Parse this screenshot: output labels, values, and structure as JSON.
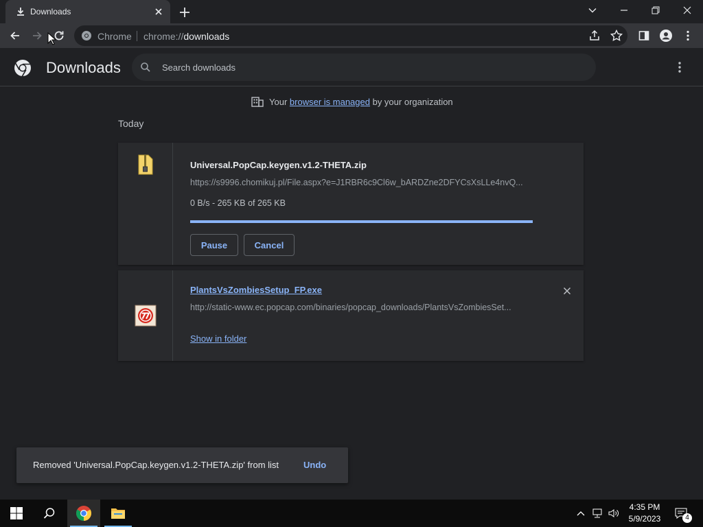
{
  "tab": {
    "title": "Downloads"
  },
  "omnibox": {
    "chip": "Chrome",
    "url_scheme": "chrome://",
    "url_host": "downloads"
  },
  "page": {
    "title": "Downloads",
    "search_placeholder": "Search downloads"
  },
  "managed": {
    "prefix": "Your",
    "link": "browser is managed",
    "suffix": "by your organization"
  },
  "section_date": "Today",
  "downloads": [
    {
      "name": "Universal.PopCap.keygen.v1.2-THETA.zip",
      "url": "https://s9996.chomikuj.pl/File.aspx?e=J1RBR6c9Cl6w_bARDZne2DFYCsXsLLe4nvQ...",
      "status": "0 B/s - 265 KB of 265 KB",
      "progress": 1.0,
      "pause_label": "Pause",
      "cancel_label": "Cancel"
    },
    {
      "name": "PlantsVsZombiesSetup_FP.exe",
      "url": "http://static-www.ec.popcap.com/binaries/popcap_downloads/PlantsVsZombiesSet...",
      "show_in_folder_label": "Show in folder"
    }
  ],
  "toast": {
    "message": "Removed 'Universal.PopCap.keygen.v1.2-THETA.zip' from list",
    "undo_label": "Undo"
  },
  "taskbar": {
    "time": "4:35 PM",
    "date": "5/9/2023",
    "notification_count": "4"
  },
  "colors": {
    "accent": "#8ab4f8",
    "background": "#202124",
    "card": "#292a2d"
  }
}
